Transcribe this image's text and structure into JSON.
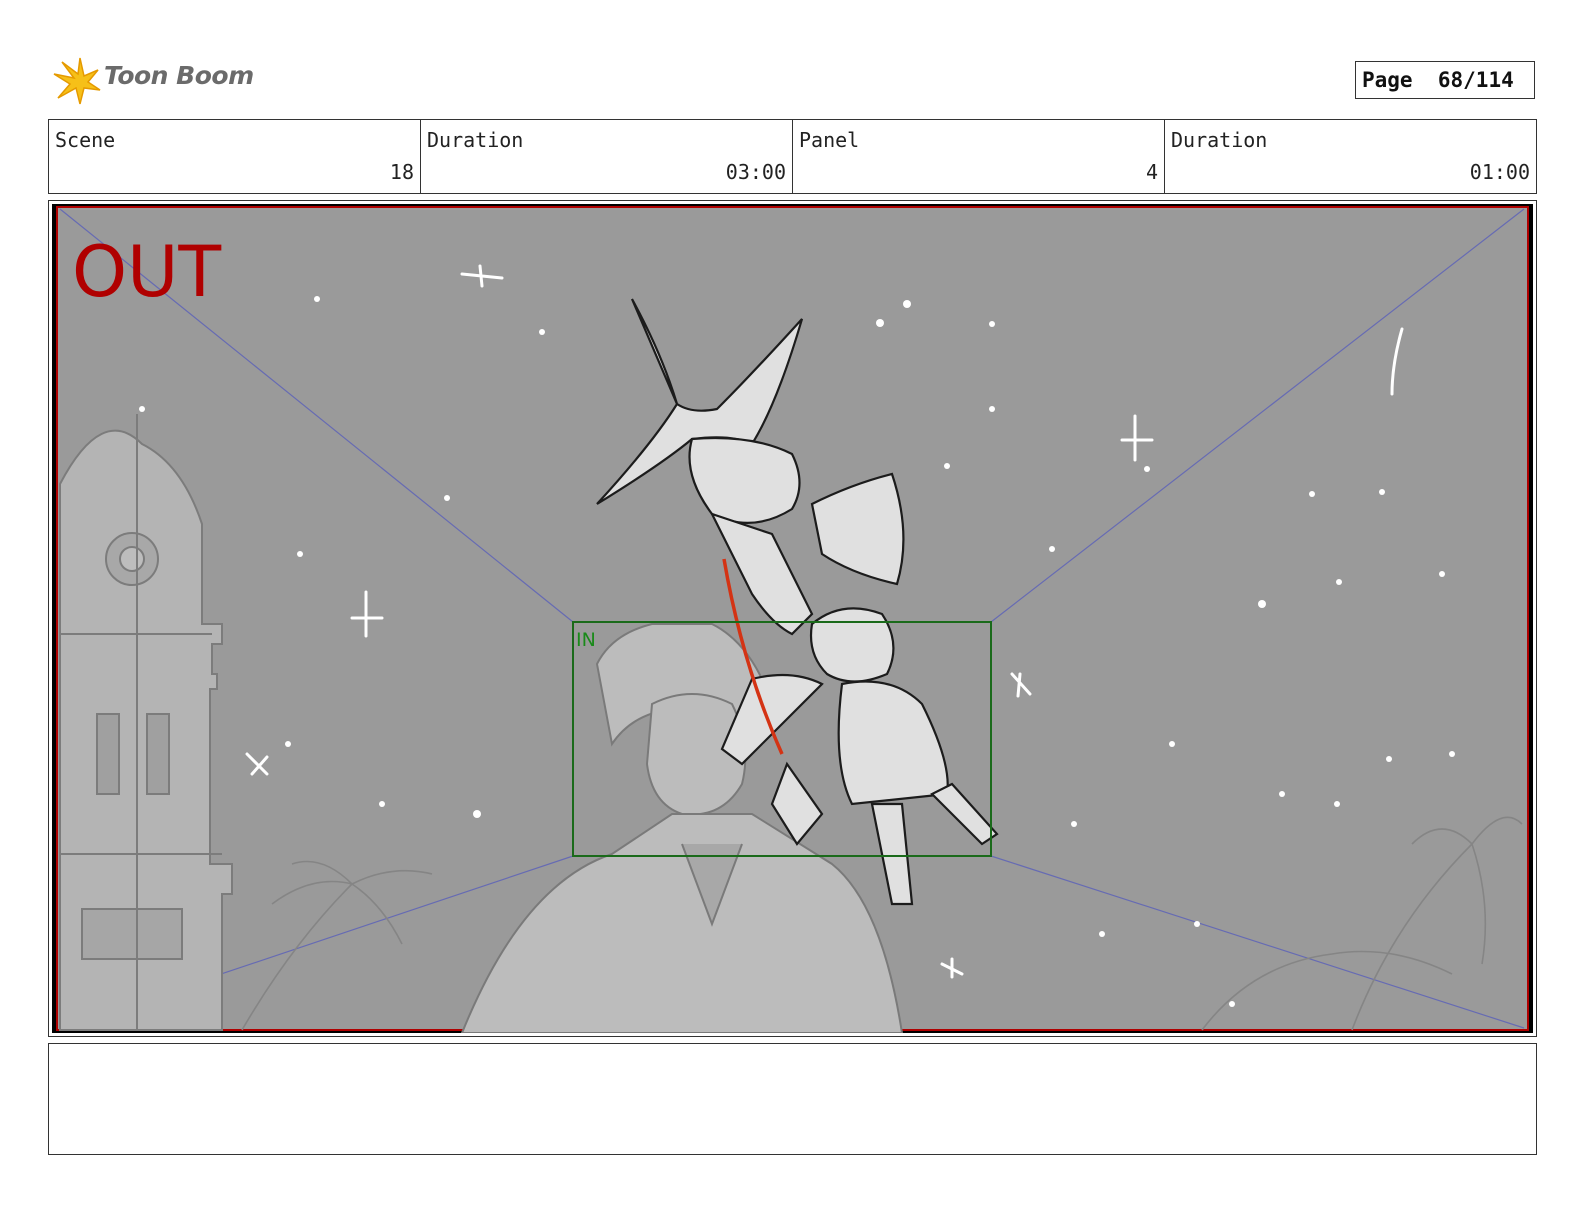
{
  "header": {
    "logo_text": "Toon Boom",
    "page_label": "Page",
    "page_value": "68/114"
  },
  "info": [
    {
      "label": "Scene",
      "value": "18"
    },
    {
      "label": "Duration",
      "value": "03:00"
    },
    {
      "label": "Panel",
      "value": "4"
    },
    {
      "label": "Duration",
      "value": "01:00"
    }
  ],
  "panel": {
    "out_label": "OUT",
    "in_label": "IN"
  },
  "colors": {
    "sky": "#9a9a9a",
    "out_red": "#b00000",
    "in_green": "#1a8a1a",
    "guide_blue": "#5e63b8"
  },
  "notes": {
    "text": ""
  }
}
